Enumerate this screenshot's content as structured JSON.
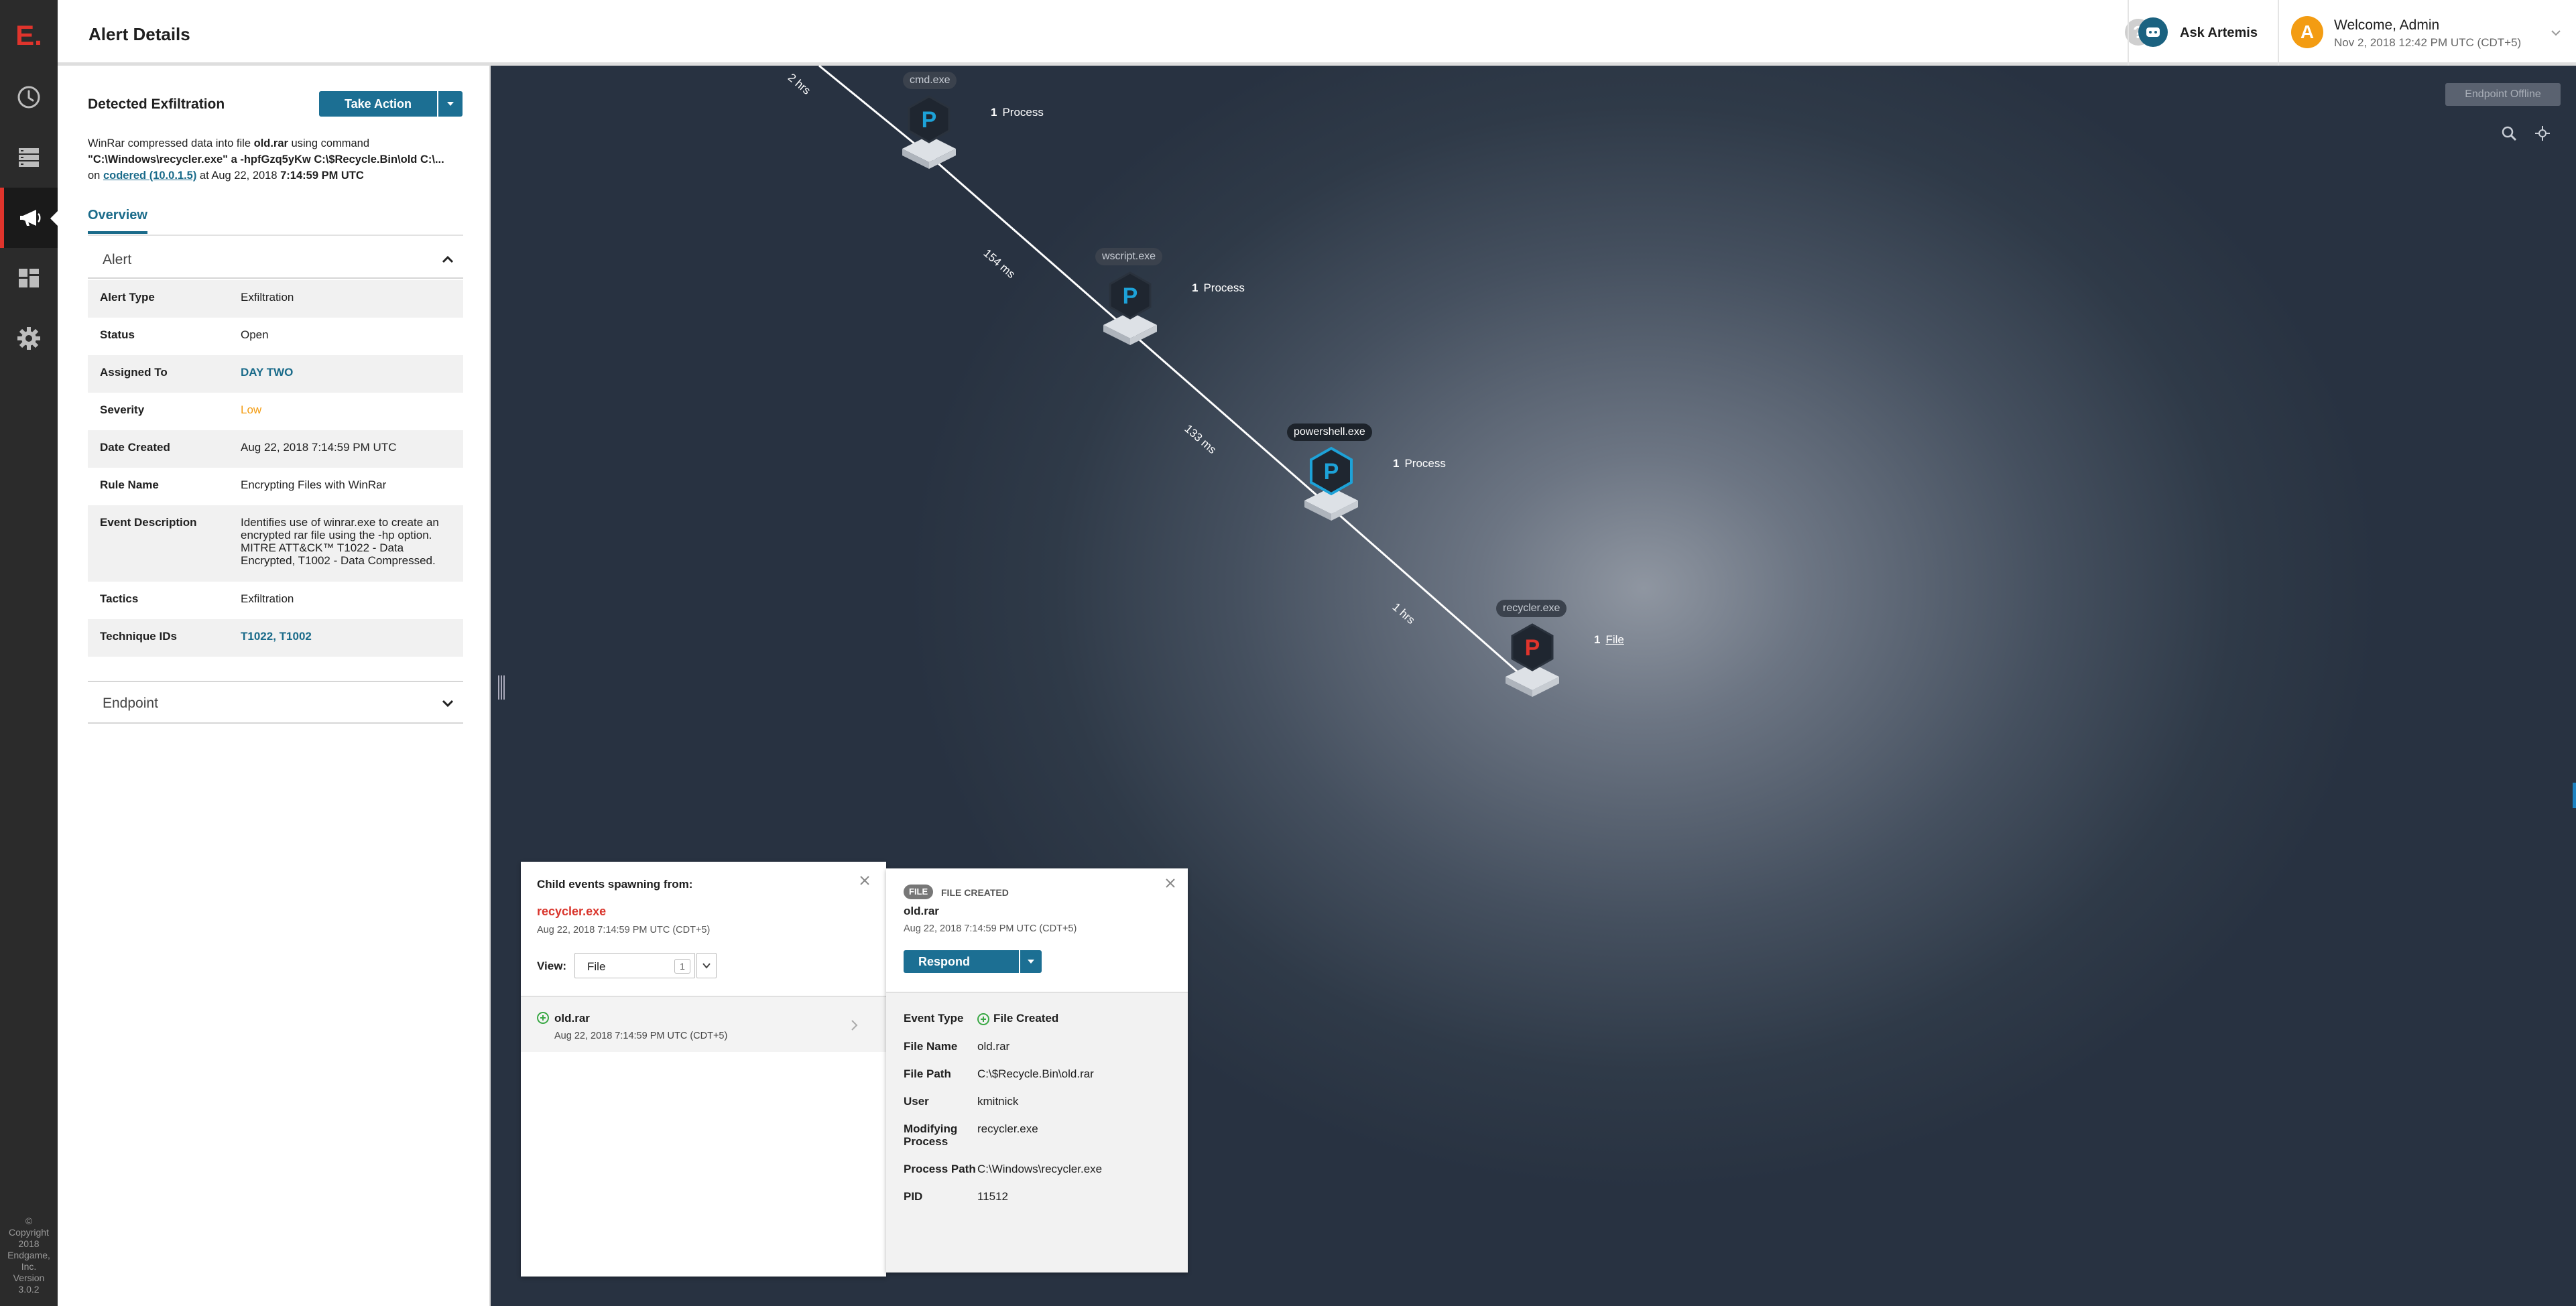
{
  "header": {
    "title": "Alert Details",
    "help_icon": "?",
    "ask_artemis": "Ask Artemis",
    "avatar_letter": "A",
    "welcome": "Welcome, Admin",
    "datetime": "Nov 2, 2018 12:42 PM UTC (CDT+5)"
  },
  "sidebar": {
    "logo": "E.",
    "items": [
      "clock-icon",
      "server-icon",
      "megaphone-icon",
      "dashboard-icon",
      "gear-icon"
    ],
    "copyright": [
      "©",
      "Copyright",
      "2018",
      "Endgame,",
      "Inc.",
      "Version",
      "3.0.2"
    ]
  },
  "alert": {
    "title": "Detected Exfiltration",
    "take_action": "Take Action",
    "desc_pre": "WinRar compressed data into file ",
    "desc_file": "old.rar",
    "desc_mid": " using command",
    "desc_cmd": "\"C:\\Windows\\recycler.exe\" a -hpfGzq5yKw C:\\$Recycle.Bin\\old C:\\...",
    "desc_on": "on ",
    "desc_host": "codered (10.0.1.5)",
    "desc_at": " at Aug 22, 2018 ",
    "desc_time": "7:14:59 PM UTC",
    "tab": "Overview",
    "section_alert": "Alert",
    "section_endpoint": "Endpoint",
    "fields": [
      {
        "k": "Alert Type",
        "v": "Exfiltration"
      },
      {
        "k": "Status",
        "v": "Open"
      },
      {
        "k": "Assigned To",
        "v": "DAY TWO"
      },
      {
        "k": "Severity",
        "v": "Low"
      },
      {
        "k": "Date Created",
        "v": "Aug 22, 2018 7:14:59 PM UTC"
      },
      {
        "k": "Rule Name",
        "v": "Encrypting Files with WinRar"
      },
      {
        "k": "Event Description",
        "v": "Identifies use of winrar.exe to create an encrypted rar file using the -hp option. MITRE ATT&CK™ T1022 - Data Encrypted, T1002 - Data Compressed."
      },
      {
        "k": "Tactics",
        "v": "Exfiltration"
      },
      {
        "k": "Technique IDs",
        "v": "T1022, T1002"
      }
    ]
  },
  "graph": {
    "endpoint_offline": "Endpoint Offline",
    "colors": {
      "process": "#1da2d8",
      "alert": "#e0342c"
    },
    "nodes": [
      {
        "label": "cmd.exe",
        "letter": "P",
        "count": "1",
        "count_label": "Process"
      },
      {
        "label": "wscript.exe",
        "letter": "P",
        "count": "1",
        "count_label": "Process"
      },
      {
        "label": "powershell.exe",
        "letter": "P",
        "count": "1",
        "count_label": "Process"
      },
      {
        "label": "recycler.exe",
        "letter": "P",
        "count": "1",
        "count_label": "File"
      }
    ],
    "edges": [
      "2 hrs",
      "154 ms",
      "133 ms",
      "1 hrs"
    ]
  },
  "child_events": {
    "title": "Child events spawning from:",
    "process": "recycler.exe",
    "date": "Aug 22, 2018 7:14:59 PM UTC (CDT+5)",
    "view_label": "View:",
    "view_value": "File",
    "view_count": "1",
    "item": {
      "name": "old.rar",
      "date": "Aug 22, 2018 7:14:59 PM UTC (CDT+5)"
    }
  },
  "event_detail": {
    "badge": "FILE",
    "type": "FILE CREATED",
    "name": "old.rar",
    "date": "Aug 22, 2018 7:14:59 PM UTC (CDT+5)",
    "respond": "Respond",
    "fields": [
      {
        "k": "Event Type",
        "v": "File Created"
      },
      {
        "k": "File Name",
        "v": "old.rar"
      },
      {
        "k": "File Path",
        "v": "C:\\$Recycle.Bin\\old.rar"
      },
      {
        "k": "User",
        "v": "kmitnick"
      },
      {
        "k": "Modifying Process",
        "v": "recycler.exe"
      },
      {
        "k": "Process Path",
        "v": "C:\\Windows\\recycler.exe"
      },
      {
        "k": "PID",
        "v": "11512"
      }
    ]
  }
}
